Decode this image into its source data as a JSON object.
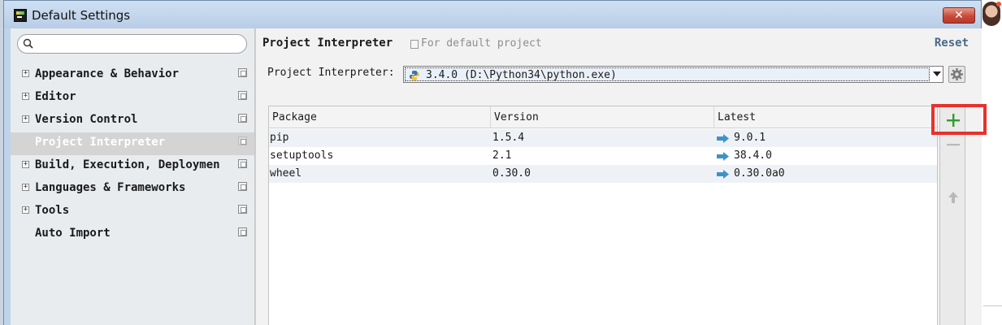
{
  "window": {
    "title": "Default Settings"
  },
  "search": {
    "placeholder": ""
  },
  "sidebar": {
    "items": [
      {
        "label": "Appearance & Behavior",
        "expandable": true,
        "selected": false
      },
      {
        "label": "Editor",
        "expandable": true,
        "selected": false
      },
      {
        "label": "Version Control",
        "expandable": true,
        "selected": false
      },
      {
        "label": "Project Interpreter",
        "expandable": false,
        "selected": true
      },
      {
        "label": "Build, Execution, Deploymen",
        "expandable": true,
        "selected": false
      },
      {
        "label": "Languages & Frameworks",
        "expandable": true,
        "selected": false
      },
      {
        "label": "Tools",
        "expandable": true,
        "selected": false
      },
      {
        "label": "Auto Import",
        "expandable": false,
        "selected": false
      }
    ]
  },
  "main": {
    "heading": "Project Interpreter",
    "scope_note": "For default project",
    "reset_label": "Reset",
    "interpreter_label": "Project Interpreter:",
    "interpreter_value": "3.4.0 (D:\\Python34\\python.exe)"
  },
  "packages": {
    "columns": [
      "Package",
      "Version",
      "Latest"
    ],
    "rows": [
      {
        "package": "pip",
        "version": "1.5.4",
        "latest": "9.0.1",
        "upgrade_available": true
      },
      {
        "package": "setuptools",
        "version": "2.1",
        "latest": "38.4.0",
        "upgrade_available": true
      },
      {
        "package": "wheel",
        "version": "0.30.0",
        "latest": "0.30.0a0",
        "upgrade_available": true
      }
    ]
  },
  "toolbar": {
    "add_icon": "plus-icon",
    "remove_icon": "minus-icon",
    "upgrade_icon": "arrow-up-icon"
  },
  "colors": {
    "add_green": "#2e9e2e",
    "highlight_red": "#e8312d",
    "upgrade_blue": "#3e93c6",
    "selection_gray": "#d4d4d4"
  }
}
